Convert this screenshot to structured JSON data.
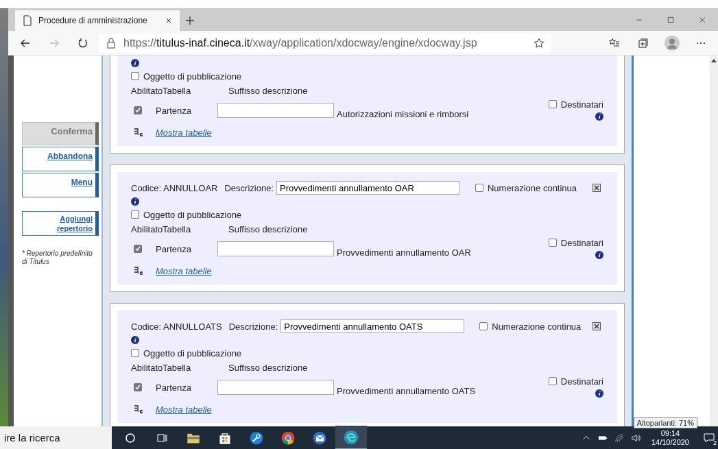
{
  "browser": {
    "tab": {
      "title": "Procedure di amministrazione",
      "selected": true
    },
    "url": "https://**titulus-inaf.cineca.it**/xway/application/xdocway/engine/xdocway.jsp"
  },
  "sidebar": {
    "buttons": [
      {
        "label": "Conferma",
        "disabled": true
      },
      {
        "label": "Abbandona",
        "disabled": false
      },
      {
        "label": "Menu",
        "disabled": false
      },
      {
        "label": "Aggiungi repertorio",
        "disabled": false
      }
    ],
    "note": "* Repertorio predefinito di Titulus"
  },
  "cards": [
    {
      "oggetto": {
        "label": "Oggetto di pubblicazione",
        "checked": false
      },
      "columns": [
        "Abilitato",
        "Tabella",
        "Suffisso descrizione"
      ],
      "rows": [
        {
          "enabled": true,
          "table": "Partenza",
          "description": "Autorizzazioni missioni e rimborsi",
          "destinatari": {
            "label": "Destinatari",
            "checked": false
          }
        }
      ],
      "link": "Mostra tabelle"
    },
    {
      "code_label": "Codice:",
      "code": "ANNULLOAR",
      "description_label": "Descrizione:",
      "description": "Provvedimenti annullamento OAR",
      "numerazione": {
        "label": "Numerazione continua",
        "checked": false
      },
      "oggetto": {
        "label": "Oggetto di pubblicazione",
        "checked": false
      },
      "columns": [
        "Abilitato",
        "Tabella",
        "Suffisso descrizione"
      ],
      "rows": [
        {
          "enabled": true,
          "table": "Partenza",
          "description": "Provvedimenti annullamento OAR",
          "destinatari": {
            "label": "Destinatari",
            "checked": false
          }
        }
      ],
      "link": "Mostra tabelle"
    },
    {
      "code_label": "Codice:",
      "code": "ANNULLOATS",
      "description_label": "Descrizione:",
      "description": "Provvedimenti annullamento OATS",
      "numerazione": {
        "label": "Numerazione continua",
        "checked": false
      },
      "oggetto": {
        "label": "Oggetto di pubblicazione",
        "checked": false
      },
      "columns": [
        "Abilitato",
        "Tabella",
        "Suffisso descrizione"
      ],
      "rows": [
        {
          "enabled": true,
          "table": "Partenza",
          "description": "Provvedimenti annullamento OATS",
          "destinatari": {
            "label": "Destinatari",
            "checked": false
          }
        }
      ],
      "link": "Mostra tabelle"
    }
  ],
  "taskbar": {
    "search": "ire la ricerca",
    "tooltip": "Altoparlanti: 71%",
    "time": "09:14",
    "date": "14/10/2020",
    "notifications": "2"
  }
}
